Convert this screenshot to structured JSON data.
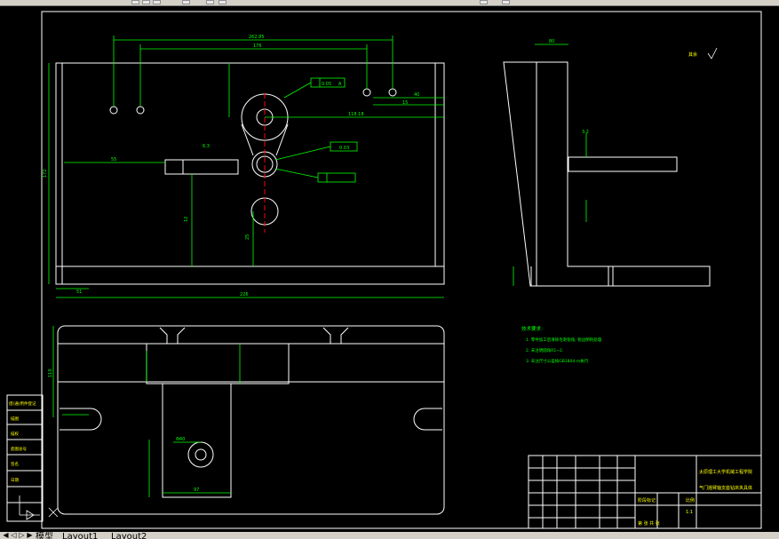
{
  "toolbar": {
    "buttons": [
      "zoom-icon",
      "pan-icon",
      "draw-icon",
      "modify-icon",
      "layer-icon",
      "properties-icon",
      "snap-icon",
      "dimension-icon"
    ]
  },
  "tabs": {
    "model": "模型",
    "layout1": "Layout1",
    "layout2": "Layout2"
  },
  "drawing": {
    "title_right": "技 术 要 求",
    "notes_title": "技术要求:",
    "notes": [
      "1. 零件加工后清除毛刺锐角, 锐边倒钝处理.",
      "2. 未注明圆角R1~2.",
      "3. 未注尺寸公差按GB1804-m执行."
    ],
    "roughness_label": "其余",
    "title_block": {
      "school": "太原理工大学机械工程学院",
      "part_name": "气门摇臂轴支座钻床夹具体",
      "scale_label": "比例",
      "scale": "1:1",
      "stage_label": "阶段标记",
      "sheet": "第 张 共 张"
    },
    "side_stamp": [
      "借(通)用件登记",
      "描图",
      "描校",
      "底图总号",
      "签名",
      "日期"
    ],
    "dims": {
      "top_overall": "262.85",
      "top_inner": "176",
      "width_bottom": "226",
      "height_left": "172",
      "hole_pos": "118.18",
      "hole_pos2": "40",
      "offset": "15",
      "side_width": "80",
      "bottom_dim1": "51",
      "plan_height": "110",
      "plan_left": "55",
      "plan_w": "97",
      "plan_hole": "Φ40",
      "ref_a": "A",
      "tol1": "0.05",
      "tol2": "0.03",
      "rough": "6.3",
      "rough2": "3.2",
      "sec1": "12",
      "sec2": "25"
    }
  },
  "colors": {
    "background": "#000000",
    "lines": "#ffffff",
    "dimensions": "#00ff00",
    "centerline": "#ff0000",
    "toolbar": "#d4d0c8"
  }
}
